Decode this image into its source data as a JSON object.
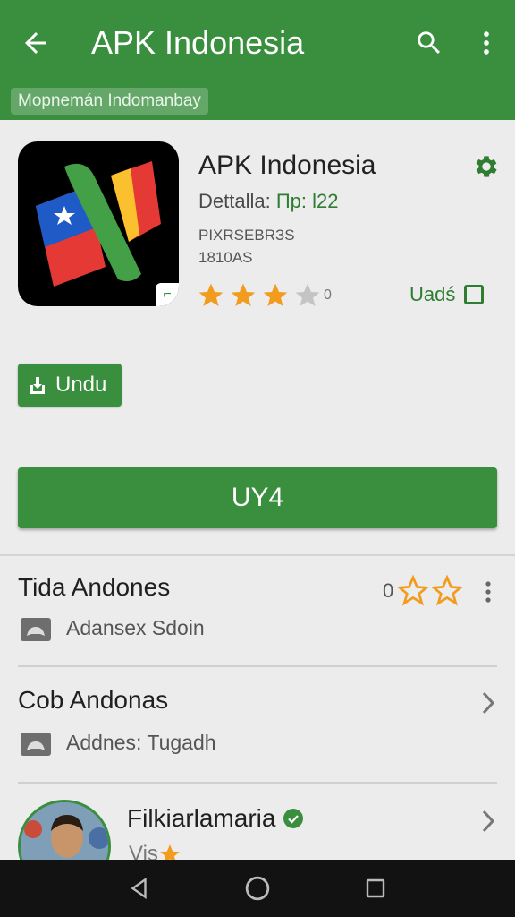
{
  "appbar": {
    "title": "APK Indonesia"
  },
  "subbar": {
    "chip": "Mopnemán  Indomanbay"
  },
  "app": {
    "title": "APK Indonesia",
    "detail_label": "Dettalla:",
    "detail_value": "Пр: l22",
    "meta1": "PIXRSEBRЗS",
    "meta2": "1810AS",
    "rating": 3,
    "rating_max": 4,
    "rating_count": "0",
    "uads_label": "Uadś"
  },
  "buttons": {
    "undu": "Undu",
    "primary": "UY4"
  },
  "list": [
    {
      "title": "Tida Andones",
      "sub": "Adansex Sdoin",
      "rating_prefix": "0"
    },
    {
      "title": "Cob Andonas",
      "sub": "Addnes: Tugadh"
    }
  ],
  "user": {
    "name": "Filkiarlamaria",
    "sub": "Vis"
  },
  "colors": {
    "primary": "#3a8f3e",
    "star": "#f29b1d",
    "star_empty": "#c4c4c4"
  }
}
